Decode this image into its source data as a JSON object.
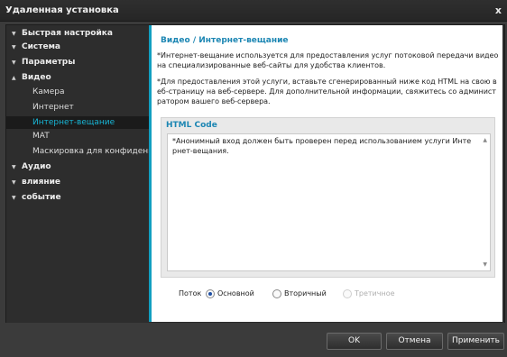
{
  "window": {
    "title": "Удаленная установка",
    "close_glyph": "x"
  },
  "sidebar": {
    "items": [
      {
        "label": "Быстрая настройка",
        "level": 0
      },
      {
        "label": "Система",
        "level": 0
      },
      {
        "label": "Параметры",
        "level": 0
      },
      {
        "label": "Видео",
        "level": 0
      },
      {
        "label": "Камера",
        "level": 1
      },
      {
        "label": "Интернет",
        "level": 1
      },
      {
        "label": "Интернет-вещание",
        "level": 1,
        "selected": true
      },
      {
        "label": "MAT",
        "level": 1
      },
      {
        "label": "Маскировка для конфиденциальности",
        "level": 1
      },
      {
        "label": "Аудио",
        "level": 0
      },
      {
        "label": "влияние",
        "level": 0
      },
      {
        "label": "событие",
        "level": 0
      }
    ]
  },
  "content": {
    "heading": "Видео / Интернет-вещание",
    "para1": "*Интернет-вещание используется для предоставления услуг потоковой передачи видео на специализированные веб-сайты для удобства клиентов.",
    "para2": "*Для предоставления этой услуги, вставьте сгенерированный ниже код HTML на свою в еб-страницу на веб-сервере. Для дополнительной информации, свяжитесь со админист ратором вашего веб-сервера.",
    "code_title": "HTML Code",
    "code_text": "*Анонимный вход должен быть проверен перед использованием услуги Инте рнет-вещания.",
    "stream": {
      "label": "Поток",
      "options": [
        {
          "label": "Основной",
          "checked": true,
          "disabled": false
        },
        {
          "label": "Вторичный",
          "checked": false,
          "disabled": false
        },
        {
          "label": "Третичное",
          "checked": false,
          "disabled": true
        }
      ]
    }
  },
  "buttons": {
    "ok": "OK",
    "cancel": "Отмена",
    "apply": "Применить"
  },
  "colors": {
    "accent": "#129ec0",
    "heading": "#1c86b3",
    "selected_text": "#18b6d6"
  }
}
